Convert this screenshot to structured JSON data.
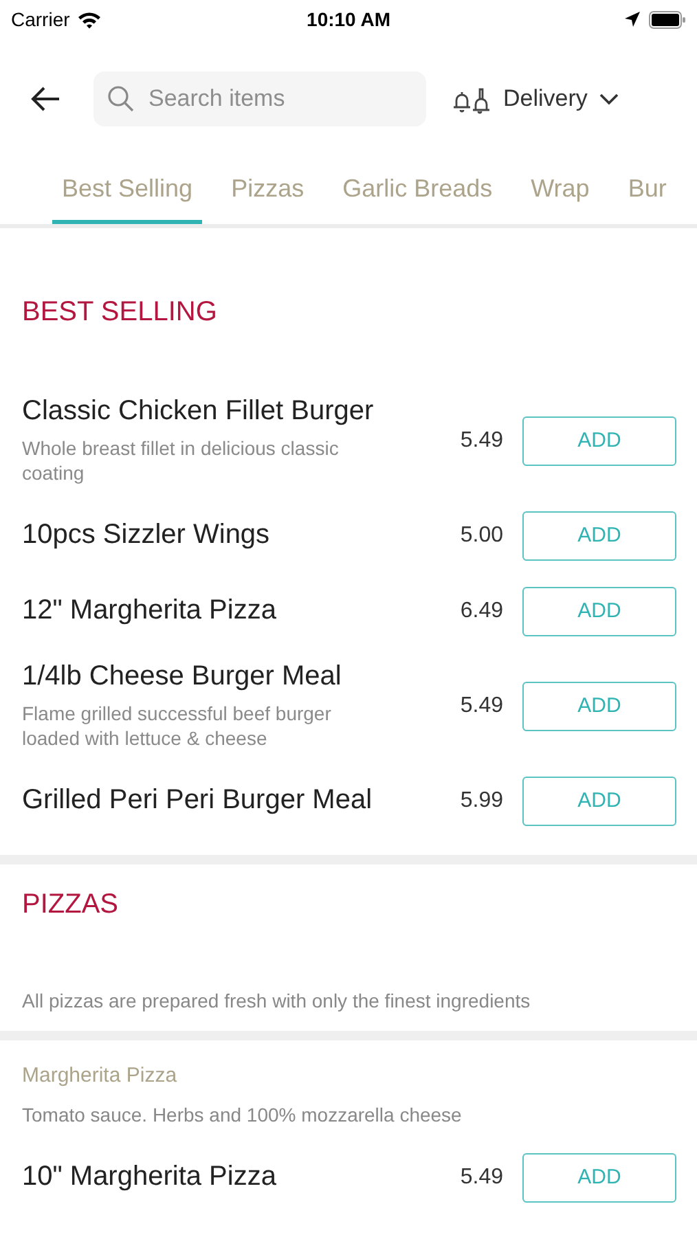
{
  "status_bar": {
    "carrier": "Carrier",
    "time": "10:10 AM"
  },
  "header": {
    "search": {
      "placeholder": "Search items"
    },
    "mode": "Delivery"
  },
  "tabs": [
    {
      "label": "Best Selling",
      "selected": true
    },
    {
      "label": "Pizzas",
      "selected": false
    },
    {
      "label": "Garlic Breads",
      "selected": false
    },
    {
      "label": "Wrap",
      "selected": false
    },
    {
      "label": "Bur",
      "selected": false
    }
  ],
  "sections": [
    {
      "title": "BEST SELLING",
      "groups": [
        {
          "items": [
            {
              "name": "Classic Chicken Fillet Burger",
              "description": "Whole breast fillet in delicious classic coating",
              "price": "5.49",
              "button": "ADD"
            },
            {
              "name": "10pcs Sizzler Wings",
              "price": "5.00",
              "button": "ADD"
            },
            {
              "name": "12\" Margherita Pizza",
              "price": "6.49",
              "button": "ADD"
            },
            {
              "name": "1/4lb Cheese Burger Meal",
              "description": "Flame grilled successful beef burger loaded with lettuce & cheese",
              "price": "5.49",
              "button": "ADD"
            },
            {
              "name": "Grilled Peri Peri Burger Meal",
              "price": "5.99",
              "button": "ADD"
            }
          ]
        }
      ]
    },
    {
      "title": "PIZZAS",
      "note": "All pizzas are prepared fresh with only the finest ingredients",
      "groups": [
        {
          "title": "Margherita Pizza",
          "description": "Tomato sauce. Herbs and 100% mozzarella cheese",
          "items": [
            {
              "name": "10\" Margherita Pizza",
              "price": "5.49",
              "button": "ADD"
            }
          ]
        }
      ]
    }
  ]
}
